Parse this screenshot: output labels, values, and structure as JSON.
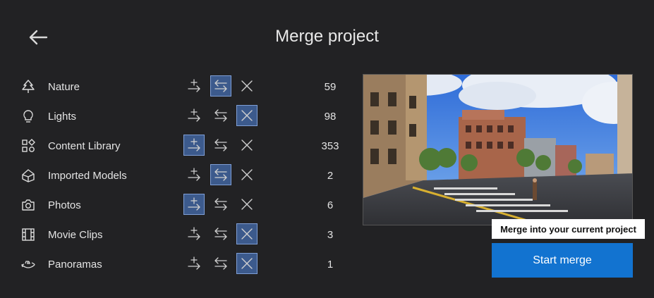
{
  "header": {
    "title": "Merge project",
    "back_icon": "arrow-left-icon"
  },
  "categories": [
    {
      "label": "Nature",
      "icon": "tree-icon",
      "count": "59",
      "selected_option": "swap"
    },
    {
      "label": "Lights",
      "icon": "lightbulb-icon",
      "count": "98",
      "selected_option": "skip"
    },
    {
      "label": "Content Library",
      "icon": "shapes-icon",
      "count": "353",
      "selected_option": "add"
    },
    {
      "label": "Imported Models",
      "icon": "cube-icon",
      "count": "2",
      "selected_option": "swap"
    },
    {
      "label": "Photos",
      "icon": "camera-icon",
      "count": "6",
      "selected_option": "add"
    },
    {
      "label": "Movie Clips",
      "icon": "film-icon",
      "count": "3",
      "selected_option": "skip"
    },
    {
      "label": "Panoramas",
      "icon": "360-icon",
      "count": "1",
      "selected_option": "skip"
    }
  ],
  "tooltip": "Merge into your current project",
  "start_button": "Start merge",
  "colors": {
    "background": "#222224",
    "selected_option": "#3c5a8c",
    "primary_button": "#1273d0"
  }
}
